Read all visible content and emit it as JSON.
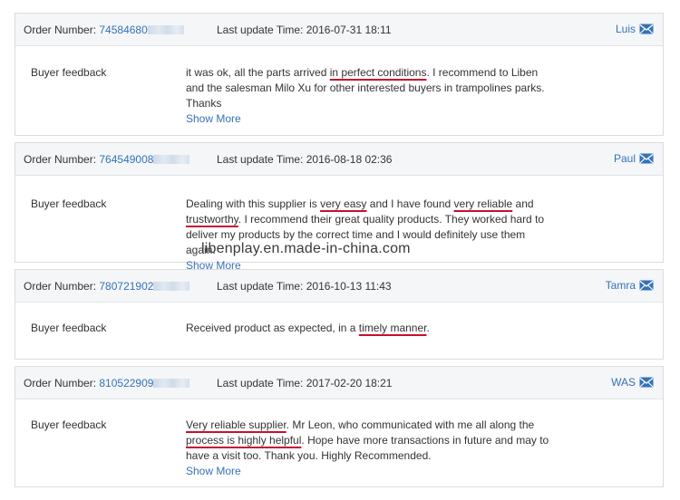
{
  "colors": {
    "link": "#3572b8",
    "underline": "#c8102e",
    "header_bg": "#f4f6f8"
  },
  "labels": {
    "order_number": "Order Number:",
    "last_update": "Last update Time:",
    "buyer_feedback": "Buyer feedback",
    "show_more": "Show More"
  },
  "watermark": "libenplay.en.made-in-china.com",
  "reviews": [
    {
      "order_number": "74584680",
      "time": "2016-07-31 18:11",
      "user": "Luis",
      "feedback": {
        "p1": "it was ok, all the parts arrived ",
        "u1": "in perfect conditions",
        "p2": ". I recommend to Liben and the salesman Milo Xu for other interested buyers in trampolines parks. Thanks"
      }
    },
    {
      "order_number": "764549008",
      "time": "2016-08-18 02:36",
      "user": "Paul",
      "feedback": {
        "p1": "Dealing with this supplier is ",
        "u1": "very easy",
        "p2": " and I have found ",
        "u2": "very reliable",
        "p3": " and ",
        "u3": "trustworthy",
        "p4": ". I recommend their great quality products. They worked hard to deliver my products by the correct time and I would definitely use them again."
      }
    },
    {
      "order_number": "780721902",
      "time": "2016-10-13 11:43",
      "user": "Tamra",
      "feedback": {
        "p1": "Received product as expected, in a ",
        "u1": "timely manner",
        "p2": "."
      }
    },
    {
      "order_number": "810522909",
      "time": "2017-02-20 18:21",
      "user": "WAS",
      "feedback": {
        "u1": "Very reliable supplier",
        "p1": ". Mr Leon, who communicated with me all along the ",
        "u2": "process is highly helpful",
        "p2": ". Hope have more transactions in future and may to have a visit too. Thank you. Highly Recommended."
      }
    }
  ]
}
